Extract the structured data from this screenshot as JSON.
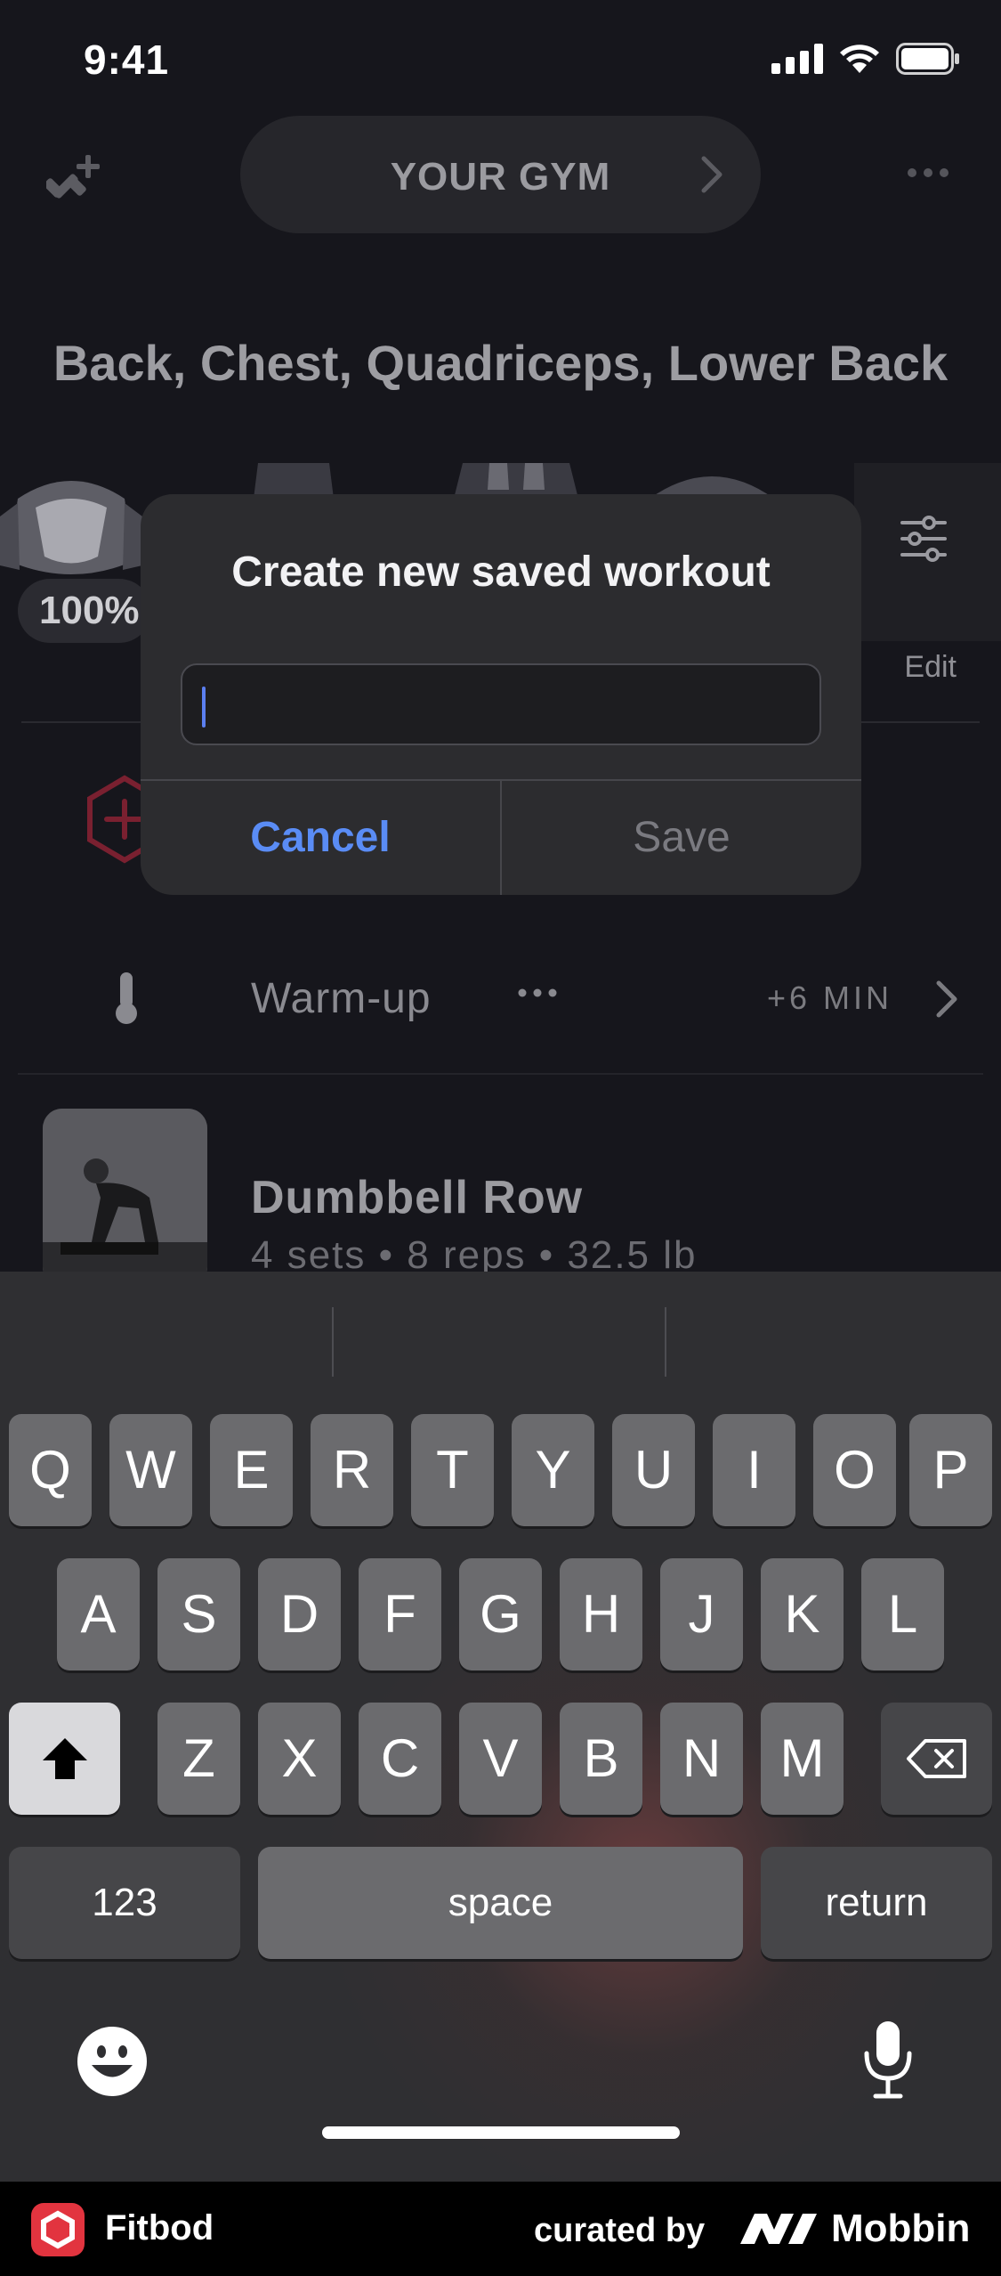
{
  "status_bar": {
    "time": "9:41"
  },
  "topbar": {
    "gym_label": "YOUR GYM"
  },
  "muscles": {
    "title": "Back, Chest, Quadriceps, Lower Back",
    "recovery_pct": "100%",
    "edit_label": "Edit"
  },
  "warmup": {
    "label": "Warm-up",
    "duration": "+6 MIN"
  },
  "exercise": {
    "name": "Dumbbell Row",
    "meta": "4 sets • 8 reps • 32.5 lb"
  },
  "dialog": {
    "title": "Create new saved workout",
    "input_value": "",
    "cancel_label": "Cancel",
    "save_label": "Save"
  },
  "keyboard": {
    "row1": [
      "Q",
      "W",
      "E",
      "R",
      "T",
      "Y",
      "U",
      "I",
      "O",
      "P"
    ],
    "row2": [
      "A",
      "S",
      "D",
      "F",
      "G",
      "H",
      "J",
      "K",
      "L"
    ],
    "row3": [
      "Z",
      "X",
      "C",
      "V",
      "B",
      "N",
      "M"
    ],
    "numbers_label": "123",
    "space_label": "space",
    "return_label": "return"
  },
  "footer": {
    "app_name": "Fitbod",
    "curated_by": "curated by",
    "brand": "Mobbin"
  },
  "colors": {
    "accent_blue": "#5a8cf5",
    "brand_red": "#e2343f",
    "background": "#16161c"
  }
}
